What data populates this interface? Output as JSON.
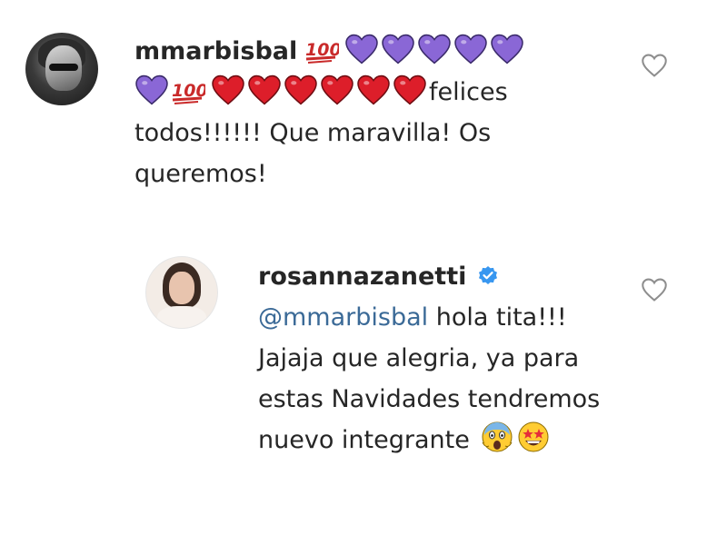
{
  "comments": [
    {
      "username": "mmarbisbal",
      "avatar_icon": "profile-photo",
      "emojis_line1": [
        "hundred-points",
        "purple-heart",
        "purple-heart",
        "purple-heart",
        "purple-heart",
        "purple-heart"
      ],
      "emojis_line2": [
        "purple-heart",
        "hundred-points",
        "red-heart",
        "red-heart",
        "red-heart",
        "red-heart",
        "red-heart",
        "red-heart"
      ],
      "text": "felices todos!!!!!! Que maravilla! Os queremos!",
      "like_icon": "heart-outline-icon"
    },
    {
      "username": "rosannazanetti",
      "verified": true,
      "mention": "@mmarbisbal",
      "text": "hola tita!!! Jajaja que alegria, ya para estas Navidades tendremos nuevo integrante",
      "trailing_emojis": [
        "face-screaming-in-fear",
        "star-struck"
      ],
      "like_icon": "heart-outline-icon"
    }
  ],
  "colors": {
    "text": "#262626",
    "mention": "#3b6a97",
    "verified_badge": "#3897f0",
    "purple_heart": "#8a67d6",
    "red_heart": "#dd1e2a",
    "hundred_red": "#c92a2a",
    "like_outline": "#8e8e8e"
  }
}
